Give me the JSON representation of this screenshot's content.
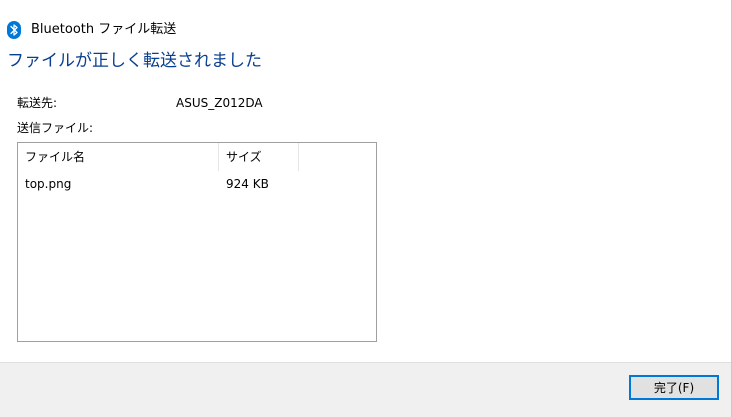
{
  "window": {
    "title": "Bluetooth ファイル転送",
    "icon": "bluetooth-icon"
  },
  "heading": "ファイルが正しく転送されました",
  "destination": {
    "label": "転送先:",
    "value": "ASUS_Z012DA"
  },
  "files": {
    "label": "送信ファイル:",
    "columns": [
      "ファイル名",
      "サイズ"
    ],
    "rows": [
      {
        "name": "top.png",
        "size": "924 KB"
      }
    ]
  },
  "footer": {
    "finish_button": "完了(F)"
  },
  "colors": {
    "heading": "#0a3f8f",
    "bluetooth_badge": "#0078d7",
    "button_border": "#0078d7",
    "footer_bg": "#f0f0f0"
  }
}
